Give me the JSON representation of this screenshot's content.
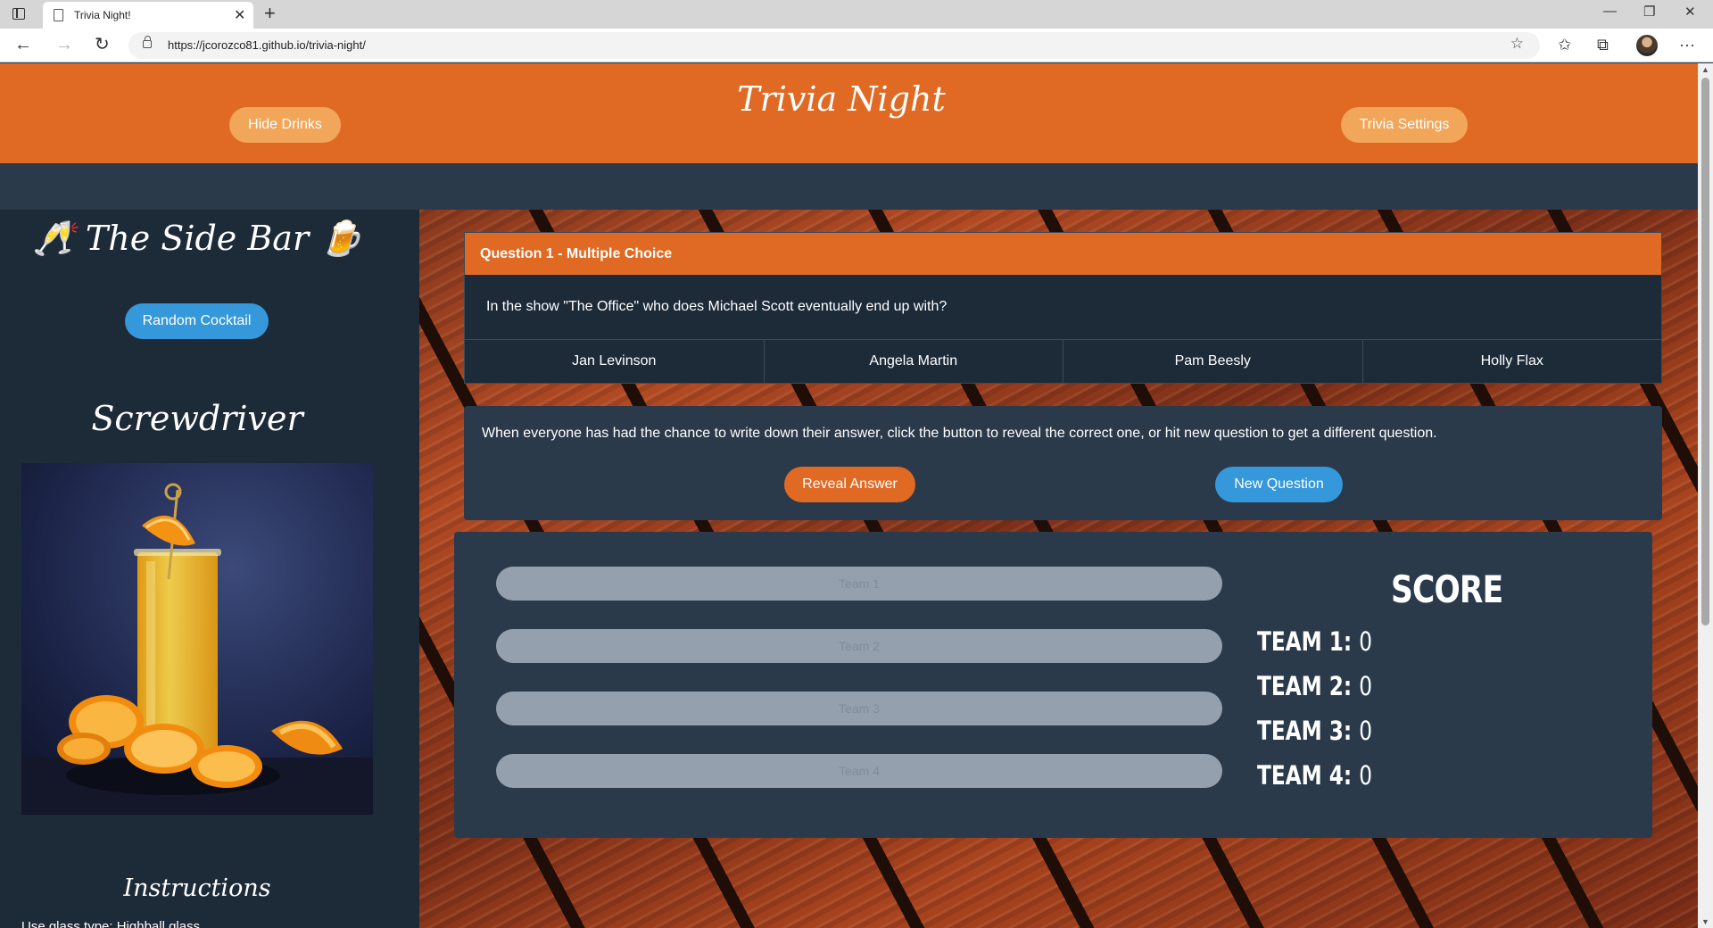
{
  "browser": {
    "tab_title": "Trivia Night!",
    "url": "https://jcorozco81.github.io/trivia-night/"
  },
  "header": {
    "title": "Trivia Night",
    "hide_drinks_label": "Hide Drinks",
    "settings_label": "Trivia Settings"
  },
  "sidebar": {
    "title": "🥂 The Side Bar 🍺",
    "random_label": "Random Cocktail",
    "drink_name": "Screwdriver",
    "instructions_title": "Instructions",
    "glass_type": "Use glass type: Highball glass"
  },
  "question": {
    "header": "Question 1 - Multiple Choice",
    "text": "In the show \"The Office\" who does Michael Scott eventually end up with?",
    "answers": [
      "Jan Levinson",
      "Angela Martin",
      "Pam Beesly",
      "Holly Flax"
    ]
  },
  "reveal": {
    "text": "When everyone has had the chance to write down their answer, click the button to reveal the correct one, or hit new question to get a different question.",
    "reveal_label": "Reveal Answer",
    "new_label": "New Question"
  },
  "score": {
    "title": "SCORE",
    "team_placeholders": [
      "Team 1",
      "Team 2",
      "Team 3",
      "Team 4"
    ],
    "teams": [
      {
        "label": "TEAM 1:",
        "value": "0"
      },
      {
        "label": "TEAM 2:",
        "value": "0"
      },
      {
        "label": "TEAM 3:",
        "value": "0"
      },
      {
        "label": "TEAM 4:",
        "value": "0"
      }
    ]
  },
  "colors": {
    "orange": "#e06a23",
    "light_orange": "#f2a65a",
    "blue": "#3498db",
    "navy": "#2b3a4b",
    "dark_navy": "#1d2a38"
  }
}
